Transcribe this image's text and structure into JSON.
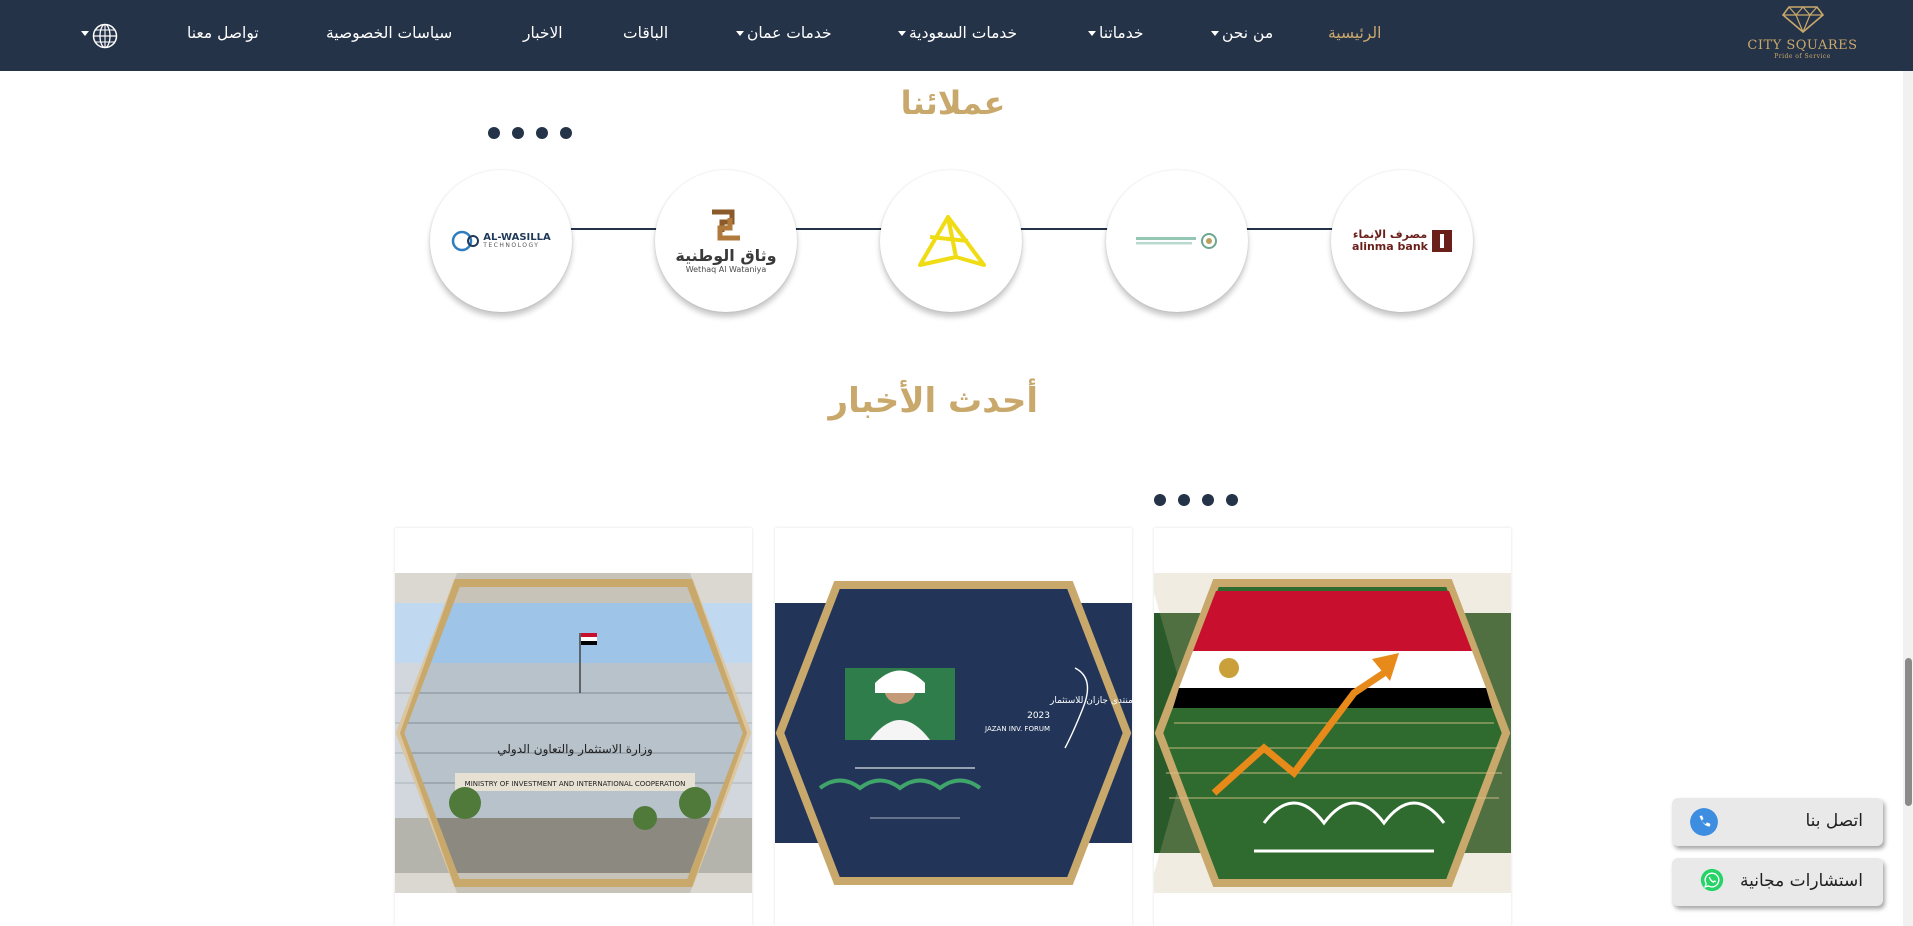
{
  "nav": {
    "logo": {
      "name": "CITY SQUARES",
      "tagline": "Pride of Service"
    },
    "items": [
      {
        "label": "الرئيسية",
        "active": true,
        "dropdown": false
      },
      {
        "label": "من نحن",
        "active": false,
        "dropdown": true
      },
      {
        "label": "خدماتنا",
        "active": false,
        "dropdown": true
      },
      {
        "label": "خدمات السعودية",
        "active": false,
        "dropdown": true
      },
      {
        "label": "خدمات عمان",
        "active": false,
        "dropdown": true
      },
      {
        "label": "الباقات",
        "active": false,
        "dropdown": false
      },
      {
        "label": "الاخبار",
        "active": false,
        "dropdown": false
      },
      {
        "label": "سياسات الخصوصية",
        "active": false,
        "dropdown": false
      },
      {
        "label": "تواصل معنا",
        "active": false,
        "dropdown": false
      }
    ],
    "language_icon": "globe-icon"
  },
  "clients": {
    "title": "عملائنا",
    "logos": [
      {
        "name": "alinma-bank-logo",
        "text_ar": "مصرف الإنماء",
        "text_en": "alinma bank"
      },
      {
        "name": "authority-logo"
      },
      {
        "name": "yellow-emblem-logo"
      },
      {
        "name": "wethaq-logo",
        "text_ar": "وثاق الوطنية",
        "text_en": "Wethaq Al Wataniya"
      },
      {
        "name": "al-wasilla-logo",
        "text_en": "AL-WASILLA",
        "text_sub": "TECHNOLOGY"
      }
    ]
  },
  "news": {
    "title": "أحدث الأخبار",
    "cards": [
      {
        "name": "saudi-egypt-flags-news"
      },
      {
        "name": "jazan-forum-news",
        "forum_ar": "منتدى جازان للاستثمار",
        "forum_year": "2023",
        "forum_en": "JAZAN INV. FORUM"
      },
      {
        "name": "ministry-building-news",
        "sign_en": "MINISTRY OF INVESTMENT AND INTERNATIONAL COOPERATION",
        "sign_ar": "وزارة الاستثمار والتعاون الدولي"
      }
    ]
  },
  "floating": {
    "contact_label": "اتصل بنا",
    "consult_label": "استشارات مجانية"
  },
  "colors": {
    "navy": "#253348",
    "gold": "#c9a86c",
    "whatsapp": "#25d366",
    "phone": "#3d8ee0"
  }
}
